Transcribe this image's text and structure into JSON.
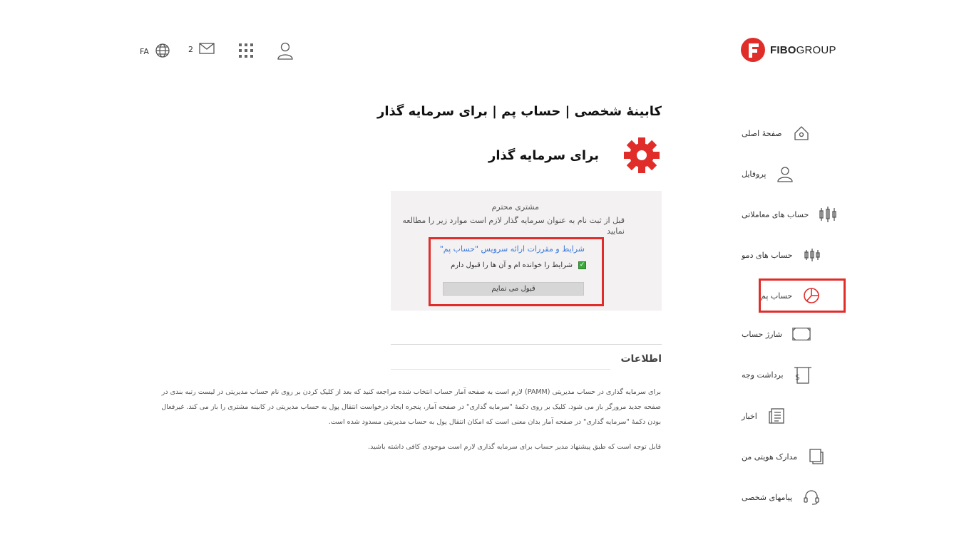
{
  "header": {
    "lang": "FA",
    "mail_count": "2",
    "logo_bold": "FIBO",
    "logo_light": "GROUP"
  },
  "sidebar": {
    "items": [
      {
        "label": "صفحهٔ اصلی",
        "icon": "home-icon"
      },
      {
        "label": "پروفایل",
        "icon": "user-icon"
      },
      {
        "label": "حساب های معاملاتی",
        "icon": "candles-icon"
      },
      {
        "label": "حساب های دمو",
        "icon": "candles-small-icon"
      },
      {
        "label": "حساب پم",
        "icon": "pamm-pie-icon"
      },
      {
        "label": "شارژ حساب",
        "icon": "deposit-icon"
      },
      {
        "label": "برداشت وجه",
        "icon": "withdraw-icon"
      },
      {
        "label": "اخبار",
        "icon": "news-icon"
      },
      {
        "label": "مدارک هویتی من",
        "icon": "documents-icon"
      },
      {
        "label": "پیامهای شخصی",
        "icon": "headset-icon"
      }
    ],
    "active_index": 4
  },
  "main": {
    "title": "کابینهٔ شخصی | حساب پم | برای سرمایه گذار",
    "subtitle": "برای سرمایه گذار",
    "panel": {
      "greeting": "مشتری محترم",
      "note": "قبل از ثبت نام به عنوان سرمایه گذار لازم است موارد زیر را مطالعه نمایید",
      "terms_link": "شرایط و مقررات ارائه سرویس \"حساب پم\"",
      "agree_label": "شرایط را خوانده ام و آن ها را قبول دارم",
      "accept_button": "قبول می نمایم"
    },
    "info_title": "اطلاعات",
    "info_p1": "برای سرمایه گذاری در حساب مدیریتی (PAMM) لازم است به صفحه آمار حساب انتخاب شده مراجعه کنید که بعد از کلیک کردن بر روی نام حساب مدیریتی در لیست رتبه بندی در صفحه جدید مرورگر باز می شود. کلیک بر روی دکمهٔ \"سرمایه گذاری\" در صفحه آمار، پنجره ایجاد درخواست انتقال پول به حساب مدیریتی در کابینه مشتری را باز می کند. غیرفعال بودن دکمهٔ \"سرمایه گذاری\" در صفحه آمار بدان معنی است که امکان انتقال پول به حساب مدیریتی مسدود شده است.",
    "info_p2": "قابل توجه است که طبق پیشنهاد مدیر حساب برای سرمایه گذاری لازم است موجودی کافی داشته باشید."
  },
  "colors": {
    "brand_red": "#e02d2a",
    "link_blue": "#3c7ad9",
    "panel_bg": "#f3f1f2"
  }
}
